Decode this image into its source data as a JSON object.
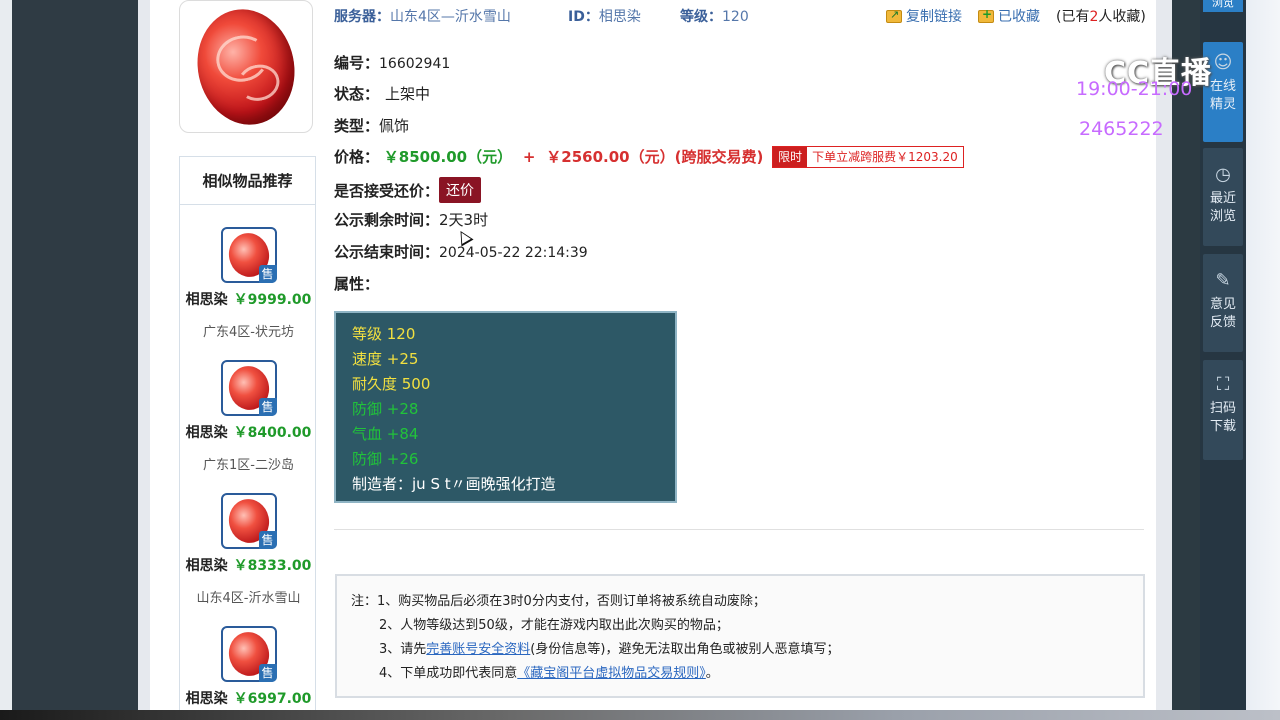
{
  "header": {
    "server_label": "服务器：",
    "server_value": "山东4区—沂水雪山",
    "id_label": "ID：",
    "id_value": "相思染",
    "level_label": "等级：",
    "level_value": "120",
    "copy_link": "复制链接",
    "favorited": "已收藏",
    "fav_prefix": "(已有",
    "fav_count": "2",
    "fav_suffix": "人收藏)"
  },
  "detail": {
    "number_label": "编号：",
    "number_value": "16602941",
    "status_label": "状态：",
    "status_value": "上架中",
    "type_label": "类型：",
    "type_value": "佩饰",
    "price_label": "价格：",
    "price_main": "￥8500.00（元）",
    "price_plus": "+",
    "price_fee": "￥2560.00（元）(跨服交易费)",
    "limit_tag": "限时",
    "limit_text": "下单立减跨服费￥1203.20",
    "bargain_label": "是否接受还价：",
    "bargain_button": "还价",
    "remaining_label": "公示剩余时间：",
    "remaining_value": "2天3时",
    "end_label": "公示结束时间：",
    "end_value": "2024-05-22 22:14:39",
    "attr_label": "属性："
  },
  "attributes": [
    {
      "text": "等级 120",
      "color": "#f2e040"
    },
    {
      "text": "速度 +25",
      "color": "#f2e040"
    },
    {
      "text": "耐久度 500",
      "color": "#f2e040"
    },
    {
      "text": "防御 +28",
      "color": "#21c33a"
    },
    {
      "text": "气血 +84",
      "color": "#21c33a"
    },
    {
      "text": "防御 +26",
      "color": "#21c33a"
    },
    {
      "text": "制造者：ju S t〃画晚强化打造",
      "color": "#ffffff"
    }
  ],
  "recommend": {
    "title": "相似物品推荐",
    "sold_tag": "售",
    "items": [
      {
        "name": "相思染",
        "price": "￥9999.00",
        "server": "广东4区-状元坊"
      },
      {
        "name": "相思染",
        "price": "￥8400.00",
        "server": "广东1区-二沙岛"
      },
      {
        "name": "相思染",
        "price": "￥8333.00",
        "server": "山东4区-沂水雪山"
      },
      {
        "name": "相思染",
        "price": "￥6997.00",
        "server": ""
      }
    ]
  },
  "notes": {
    "line1": "注：1、购买物品后必须在3时0分内支付，否则订单将被系统自动废除；",
    "line2": "2、人物等级达到50级，才能在游戏内取出此次购买的物品；",
    "line3_pre": "3、请先",
    "line3_link": "完善账号安全资料",
    "line3_post": "(身份信息等)，避免无法取出角色或被别人恶意填写；",
    "line4_pre": "4、下单成功即代表同意",
    "line4_link": "《藏宝阁平台虚拟物品交易规则》",
    "line4_post": "。"
  },
  "dock": {
    "top_partial": "浏览",
    "online": "在线精灵",
    "recent": "最近浏览",
    "feedback": "意见反馈",
    "scan": "扫码下载"
  },
  "overlay": {
    "logo": "CC直播",
    "time": "19:00-21:00",
    "room_id": "2465222"
  },
  "colors": {
    "accent_blue": "#2b7fc6",
    "price_green": "#1f9a2a",
    "price_red": "#d63030",
    "attr_bg": "#2d5866"
  }
}
